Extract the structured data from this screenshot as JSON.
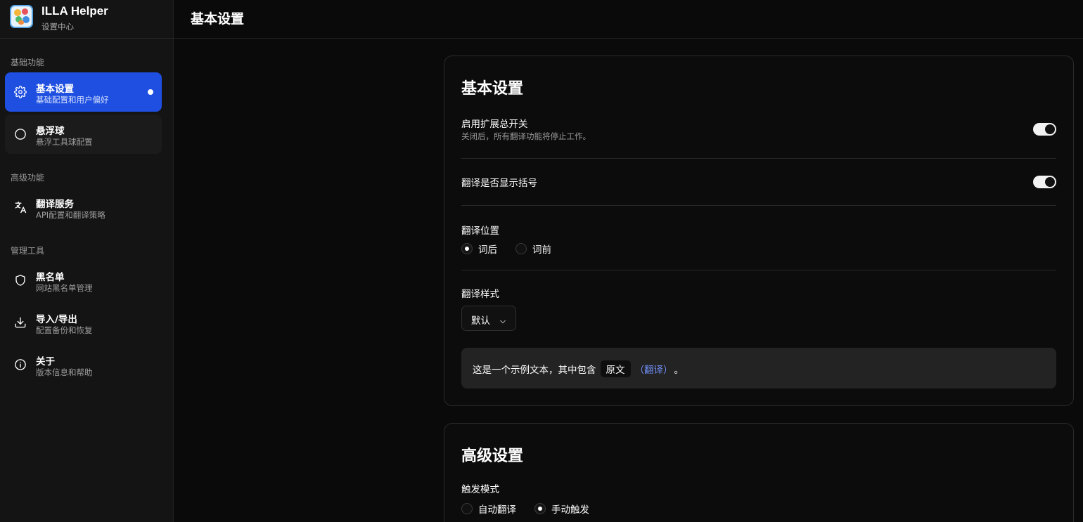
{
  "brand": {
    "title": "ILLA Helper",
    "subtitle": "设置中心"
  },
  "sidebar": {
    "sections": [
      {
        "label": "基础功能"
      },
      {
        "label": "高级功能"
      },
      {
        "label": "管理工具"
      }
    ],
    "items": [
      {
        "label": "基本设置",
        "desc": "基础配置和用户偏好",
        "icon": "gear-icon",
        "active": true
      },
      {
        "label": "悬浮球",
        "desc": "悬浮工具球配置",
        "icon": "circle-icon"
      },
      {
        "label": "翻译服务",
        "desc": "API配置和翻译策略",
        "icon": "translate-icon"
      },
      {
        "label": "黑名单",
        "desc": "网站黑名单管理",
        "icon": "shield-icon"
      },
      {
        "label": "导入/导出",
        "desc": "配置备份和恢复",
        "icon": "download-icon"
      },
      {
        "label": "关于",
        "desc": "版本信息和帮助",
        "icon": "info-icon"
      }
    ]
  },
  "header": {
    "title": "基本设置"
  },
  "basic": {
    "title": "基本设置",
    "master_switch": {
      "label": "启用扩展总开关",
      "desc": "关闭后，所有翻译功能将停止工作。",
      "on": true
    },
    "brackets": {
      "label": "翻译是否显示括号",
      "on": true
    },
    "position": {
      "label": "翻译位置",
      "options": [
        "词后",
        "词前"
      ],
      "selected": "词后"
    },
    "style": {
      "label": "翻译样式",
      "value": "默认"
    },
    "preview": {
      "text": "这是一个示例文本，其中包含",
      "original": "原文",
      "translation": "（翻译）",
      "end": "。"
    }
  },
  "advanced": {
    "title": "高级设置",
    "trigger": {
      "label": "触发模式",
      "options": [
        "自动翻译",
        "手动触发"
      ],
      "selected": "手动触发"
    }
  },
  "colors": {
    "accent": "#1e4fe0",
    "translation_text": "#6f8ef5",
    "background": "#0a0a0a"
  }
}
